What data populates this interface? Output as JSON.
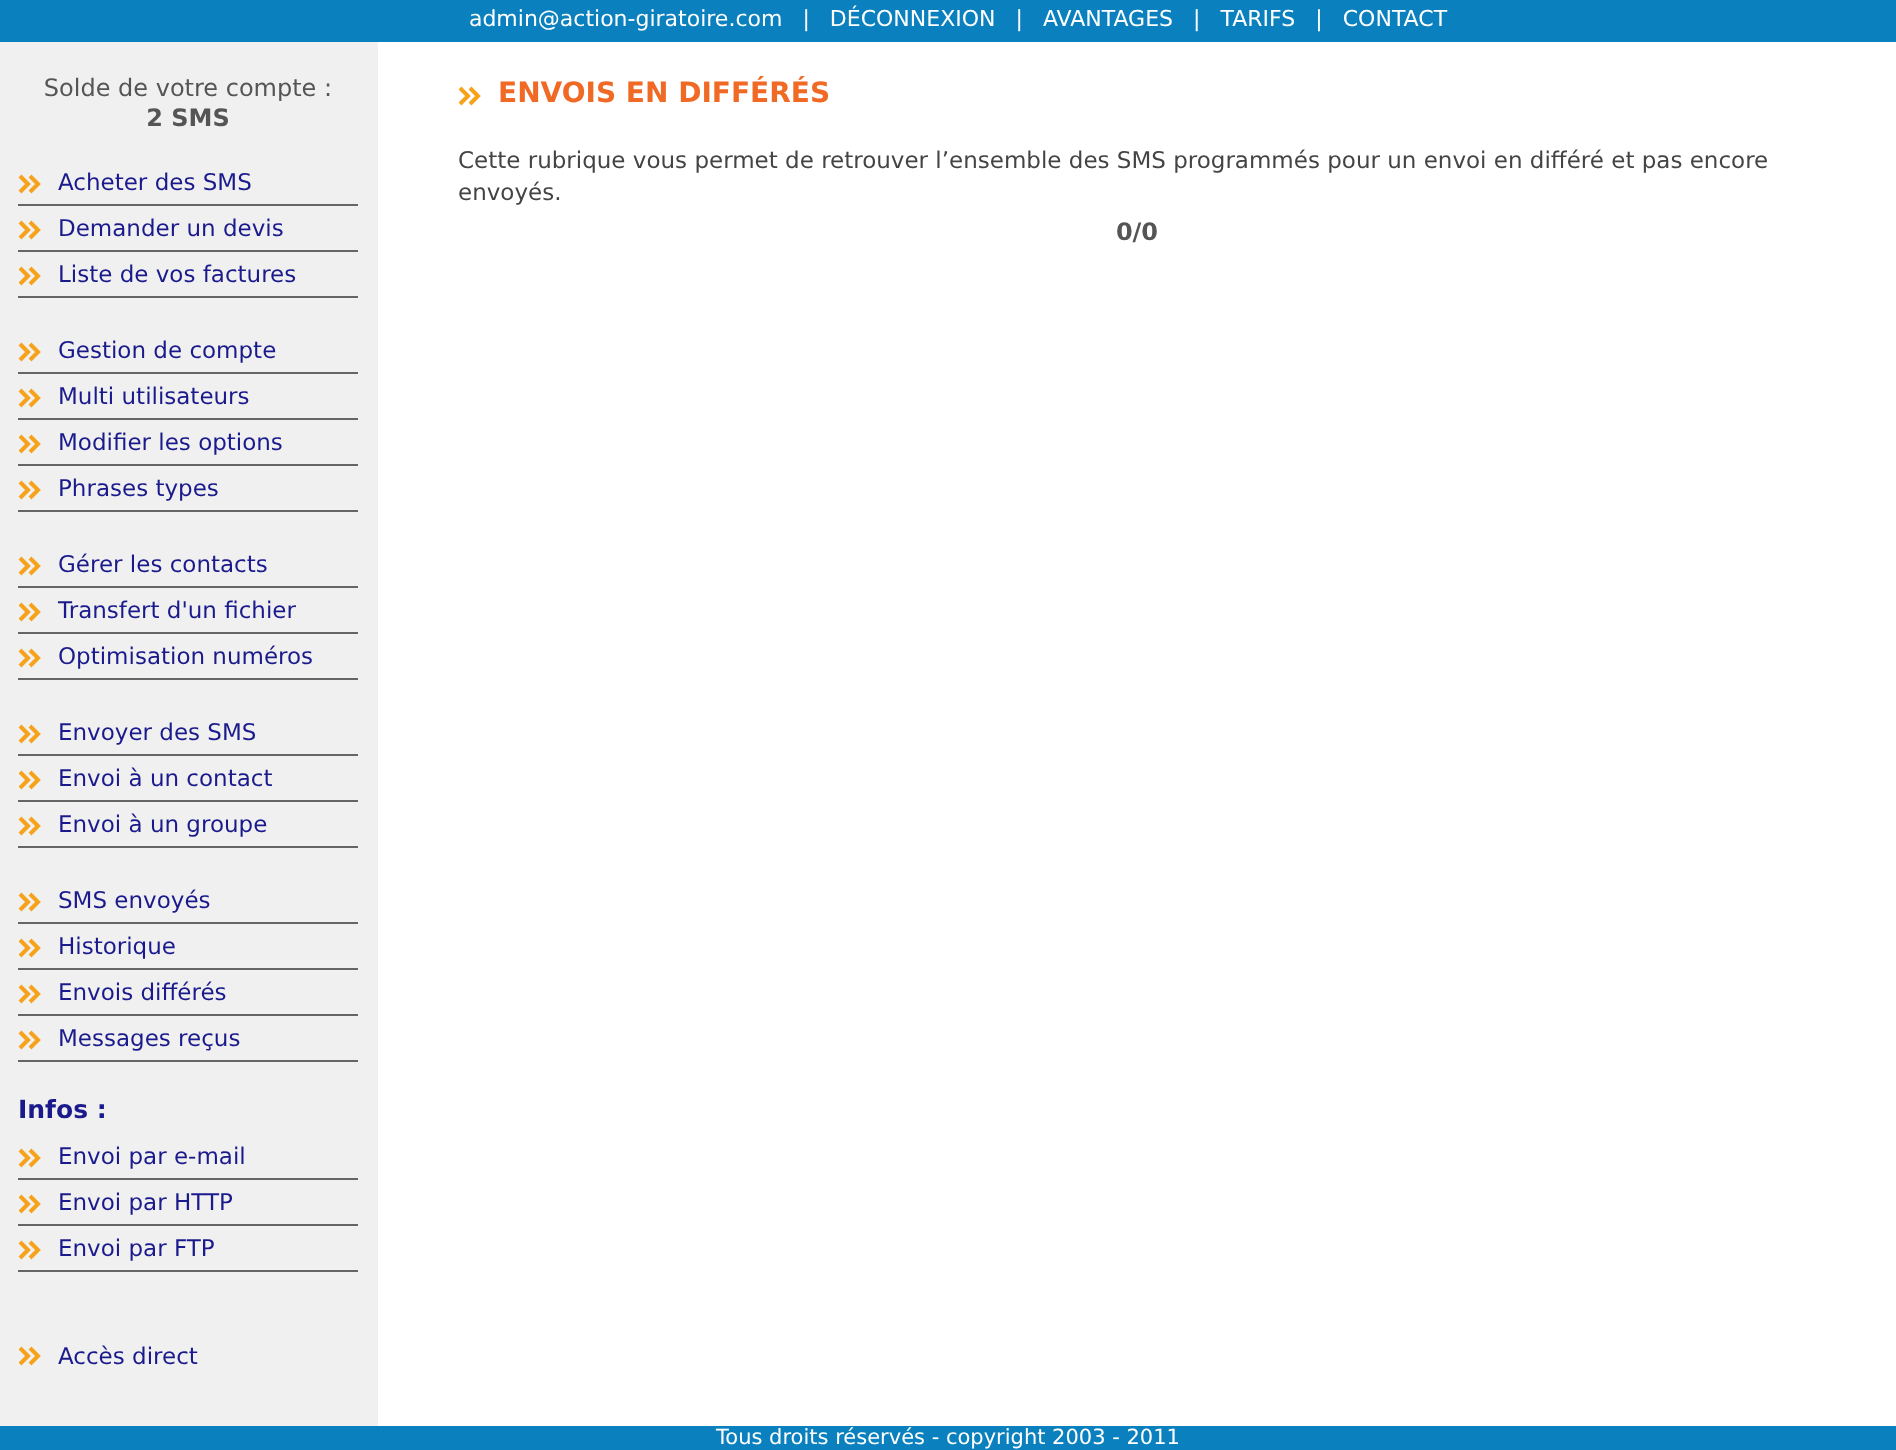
{
  "top_bar": {
    "links": [
      "admin@action-giratoire.com",
      "DÉCONNEXION",
      "AVANTAGES",
      "TARIFS",
      "CONTACT"
    ],
    "separator": "|"
  },
  "sidebar": {
    "balance_label": "Solde de votre compte :",
    "balance_value": "2 SMS",
    "groups": [
      {
        "items": [
          "Acheter des SMS",
          "Demander un devis",
          "Liste de vos factures"
        ]
      },
      {
        "items": [
          "Gestion de compte",
          "Multi utilisateurs",
          "Modifier les options",
          "Phrases types"
        ]
      },
      {
        "items": [
          "Gérer les contacts",
          "Transfert d'un fichier",
          "Optimisation numéros"
        ]
      },
      {
        "items": [
          "Envoyer des SMS",
          "Envoi à un contact",
          "Envoi à un groupe"
        ]
      },
      {
        "items": [
          "SMS envoyés",
          "Historique",
          "Envois différés",
          "Messages reçus"
        ]
      },
      {
        "heading": "Infos :",
        "items": [
          "Envoi par e-mail",
          "Envoi par HTTP",
          "Envoi par FTP"
        ]
      }
    ],
    "direct_link": "Accès direct"
  },
  "main": {
    "title": "ENVOIS EN DIFFÉRÉS",
    "description": "Cette rubrique vous permet de retrouver l’ensemble des SMS programmés pour un envoi en différé et pas encore envoyés.",
    "counter": "0/0"
  },
  "footer": "Tous droits réservés - copyright 2003 - 2011"
}
